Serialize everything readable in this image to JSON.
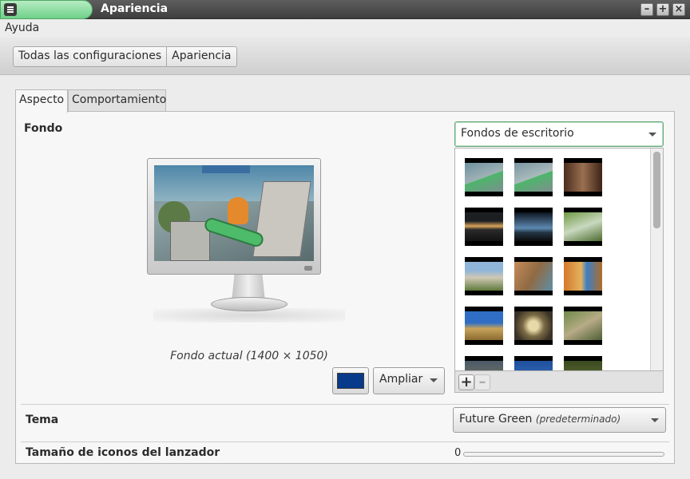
{
  "window": {
    "title": "Apariencia"
  },
  "menubar": {
    "help": "Ayuda"
  },
  "breadcrumb": {
    "items": [
      "Todas las configuraciones",
      "Apariencia"
    ]
  },
  "tabs": [
    {
      "label": "Aspecto",
      "active": true
    },
    {
      "label": "Comportamiento",
      "active": false
    }
  ],
  "background": {
    "section_label": "Fondo",
    "caption": "Fondo actual (1400 × 1050)",
    "color": "#083a8c",
    "mode": "Ampliar",
    "source": "Fondos de escritorio"
  },
  "theme": {
    "label": "Tema",
    "value": "Future Green",
    "note": "(predeterminado)"
  },
  "launcher": {
    "label": "Tamaño de iconos del lanzador",
    "value": "0"
  },
  "colors": {
    "accent": "#6fd08a",
    "titlebar": "#4a4a4a"
  }
}
